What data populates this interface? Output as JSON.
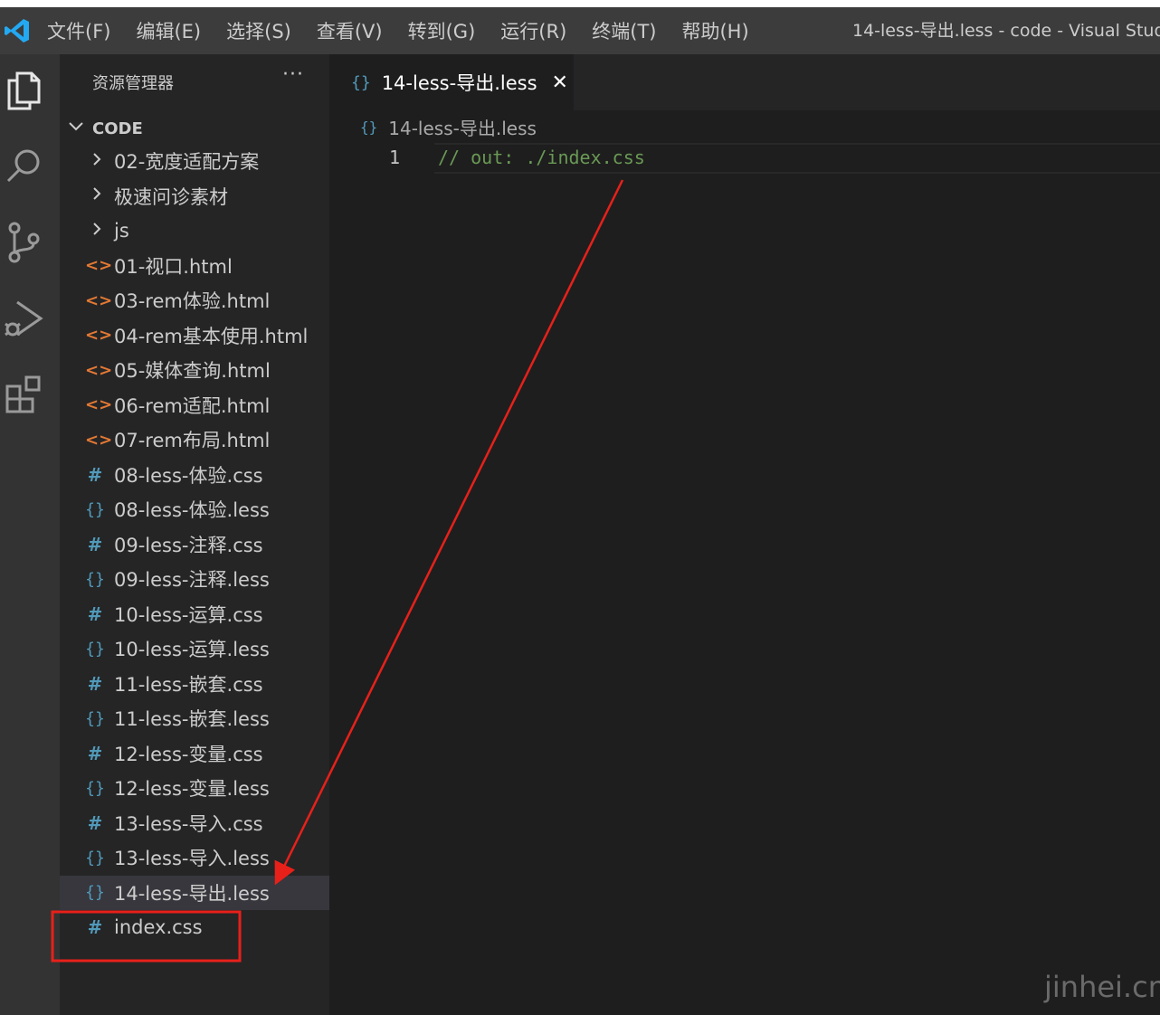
{
  "titlebar": {
    "menu": [
      "文件(F)",
      "编辑(E)",
      "选择(S)",
      "查看(V)",
      "转到(G)",
      "运行(R)",
      "终端(T)",
      "帮助(H)"
    ],
    "window_title": "14-less-导出.less - code - Visual Stud"
  },
  "activity_bar": {
    "items": [
      "explorer-icon",
      "search-icon",
      "source-control-icon",
      "run-debug-icon",
      "extensions-icon"
    ]
  },
  "sidebar": {
    "title": "资源管理器",
    "more": "···",
    "section_title": "CODE",
    "items": [
      {
        "label": "02-宽度适配方案",
        "type": "folder"
      },
      {
        "label": "极速问诊素材",
        "type": "folder"
      },
      {
        "label": "js",
        "type": "folder"
      },
      {
        "label": "01-视口.html",
        "type": "html"
      },
      {
        "label": "03-rem体验.html",
        "type": "html"
      },
      {
        "label": "04-rem基本使用.html",
        "type": "html"
      },
      {
        "label": "05-媒体查询.html",
        "type": "html"
      },
      {
        "label": "06-rem适配.html",
        "type": "html"
      },
      {
        "label": "07-rem布局.html",
        "type": "html"
      },
      {
        "label": "08-less-体验.css",
        "type": "css"
      },
      {
        "label": "08-less-体验.less",
        "type": "less"
      },
      {
        "label": "09-less-注释.css",
        "type": "css"
      },
      {
        "label": "09-less-注释.less",
        "type": "less"
      },
      {
        "label": "10-less-运算.css",
        "type": "css"
      },
      {
        "label": "10-less-运算.less",
        "type": "less"
      },
      {
        "label": "11-less-嵌套.css",
        "type": "css"
      },
      {
        "label": "11-less-嵌套.less",
        "type": "less"
      },
      {
        "label": "12-less-变量.css",
        "type": "css"
      },
      {
        "label": "12-less-变量.less",
        "type": "less"
      },
      {
        "label": "13-less-导入.css",
        "type": "css"
      },
      {
        "label": "13-less-导入.less",
        "type": "less"
      },
      {
        "label": "14-less-导出.less",
        "type": "less",
        "selected": true
      },
      {
        "label": "index.css",
        "type": "css",
        "highlighted": true
      }
    ]
  },
  "editor": {
    "tab": {
      "label": "14-less-导出.less",
      "close": "✕"
    },
    "breadcrumb": "14-less-导出.less",
    "lines": [
      {
        "number": "1",
        "text": "// out: ./index.css"
      }
    ]
  },
  "icons": {
    "html": "<>",
    "css": "#",
    "less": "{}",
    "folder_chevron": "›"
  },
  "colors": {
    "annotation": "#e8201a",
    "comment": "#6a9955",
    "less_icon": "#519aba",
    "html_icon": "#e37933"
  },
  "watermark": "jinhei.cn"
}
